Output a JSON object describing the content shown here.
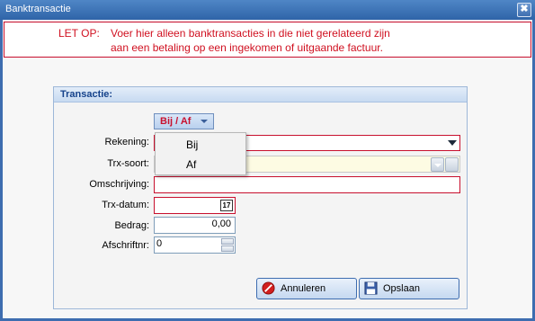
{
  "window": {
    "title": "Banktransactie",
    "close_glyph": "✖"
  },
  "warning": {
    "label": "LET OP:",
    "line1": "Voer hier alleen banktransacties in die niet gerelateerd zijn",
    "line2": "aan een betaling op een ingekomen of uitgaande factuur."
  },
  "group": {
    "title": "Transactie:"
  },
  "bij_af": {
    "selected": "Bij / Af",
    "options": [
      "Bij",
      "Af"
    ]
  },
  "fields": {
    "rekening": {
      "label": "Rekening:",
      "value": ""
    },
    "trx_soort": {
      "label": "Trx-soort:",
      "value": ""
    },
    "omschrijving": {
      "label": "Omschrijving:",
      "value": ""
    },
    "trx_datum": {
      "label": "Trx-datum:",
      "value": "",
      "cal_glyph": "17"
    },
    "bedrag": {
      "label": "Bedrag:",
      "value": "0,00"
    },
    "afschriftnr": {
      "label": "Afschriftnr:",
      "value": "0"
    }
  },
  "buttons": {
    "cancel": "Annuleren",
    "save": "Opslaan"
  },
  "colors": {
    "accent": "#3e6db0",
    "required": "#c8102e",
    "warning_text": "#d01020"
  }
}
